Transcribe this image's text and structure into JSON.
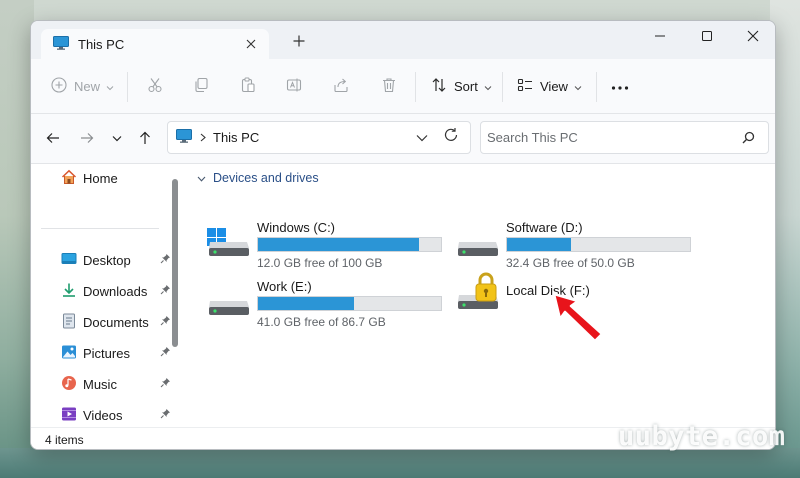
{
  "window": {
    "tab_title": "This PC",
    "minimize_icon": "minimize-icon",
    "maximize_icon": "maximize-icon",
    "close_icon": "close-icon"
  },
  "toolbar": {
    "new_label": "New",
    "sort_label": "Sort",
    "view_label": "View",
    "disabled_color": "#a0a4a8"
  },
  "address": {
    "location": "This PC",
    "search_placeholder": "Search This PC"
  },
  "sidebar": {
    "home": "Home",
    "items": [
      {
        "label": "Desktop",
        "icon": "desktop-icon"
      },
      {
        "label": "Downloads",
        "icon": "download-icon"
      },
      {
        "label": "Documents",
        "icon": "document-icon"
      },
      {
        "label": "Pictures",
        "icon": "picture-icon"
      },
      {
        "label": "Music",
        "icon": "music-icon"
      },
      {
        "label": "Videos",
        "icon": "video-icon"
      }
    ]
  },
  "content": {
    "section_title": "Devices and drives",
    "drives": [
      {
        "name": "Windows (C:)",
        "free": "12.0 GB free of 100 GB",
        "used_fraction": 0.88,
        "locked": false
      },
      {
        "name": "Software (D:)",
        "free": "32.4 GB free of 50.0 GB",
        "used_fraction": 0.352,
        "locked": false
      },
      {
        "name": "Work (E:)",
        "free": "41.0 GB free of 86.7 GB",
        "used_fraction": 0.527,
        "locked": false
      },
      {
        "name": "Local Disk (F:)",
        "free": "",
        "used_fraction": null,
        "locked": true
      }
    ]
  },
  "status": {
    "item_count": "4 items"
  },
  "colors": {
    "accent": "#2b95d6",
    "section_title": "#2a4f87",
    "arrow": "#e8141b"
  },
  "watermark": "uubyte.com"
}
